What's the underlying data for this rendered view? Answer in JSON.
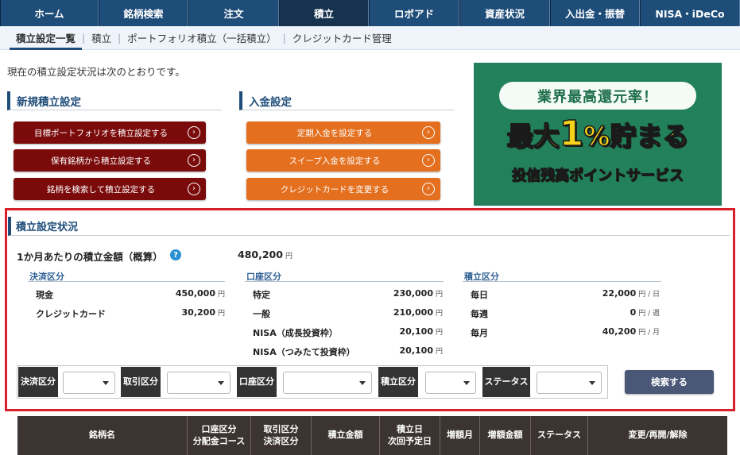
{
  "nav": {
    "items": [
      "ホーム",
      "銘柄検索",
      "注文",
      "積立",
      "ロボアド",
      "資産状況",
      "入出金・振替",
      "NISA・iDeCo"
    ]
  },
  "subnav": {
    "items": [
      "積立設定一覧",
      "積立",
      "ポートフォリオ積立（一括積立）",
      "クレジットカード管理"
    ]
  },
  "intro": "現在の積立設定状況は次のとおりです。",
  "new_section": {
    "title": "新規積立設定",
    "buttons": [
      "目標ポートフォリオを積立設定する",
      "保有銘柄から積立設定する",
      "銘柄を検索して積立設定する"
    ]
  },
  "deposit_section": {
    "title": "入金設定",
    "buttons": [
      "定期入金を設定する",
      "スイープ入金を設定する",
      "クレジットカードを変更する"
    ]
  },
  "banner": {
    "pill": "業界最高還元率！",
    "big_prefix": "最大",
    "big_num": "1",
    "big_suffix": "%貯まる",
    "sub": "投信残高ポイントサービス"
  },
  "status": {
    "title": "積立設定状況",
    "monthly_label": "1か月あたりの積立金額（概算）",
    "monthly_value": "480,200",
    "yen": "円",
    "payment": {
      "head": "決済区分",
      "rows": [
        {
          "label": "現金",
          "value": "450,000",
          "unit": "円"
        },
        {
          "label": "クレジットカード",
          "value": "30,200",
          "unit": "円"
        }
      ]
    },
    "account": {
      "head": "口座区分",
      "rows": [
        {
          "label": "特定",
          "value": "230,000",
          "unit": "円"
        },
        {
          "label": "一般",
          "value": "210,000",
          "unit": "円"
        },
        {
          "label": "NISA（成長投資枠）",
          "value": "20,100",
          "unit": "円"
        },
        {
          "label": "NISA（つみたて投資枠）",
          "value": "20,100",
          "unit": "円"
        }
      ]
    },
    "frequency": {
      "head": "積立区分",
      "rows": [
        {
          "label": "毎日",
          "value": "22,000",
          "unit": "円 / 日"
        },
        {
          "label": "毎週",
          "value": "0",
          "unit": "円 / 週"
        },
        {
          "label": "毎月",
          "value": "40,200",
          "unit": "円 / 月"
        }
      ]
    }
  },
  "filters": {
    "labels": [
      "決済区分",
      "取引区分",
      "口座区分",
      "積立区分",
      "ステータス"
    ],
    "search_button": "検索する"
  },
  "table": {
    "headers": [
      "銘柄名",
      "口座区分\n分配金コース",
      "取引区分\n決済区分",
      "積立金額",
      "積立日\n次回予定日",
      "増額月",
      "増額金額",
      "ステータス",
      "変更/再開/解除"
    ]
  }
}
